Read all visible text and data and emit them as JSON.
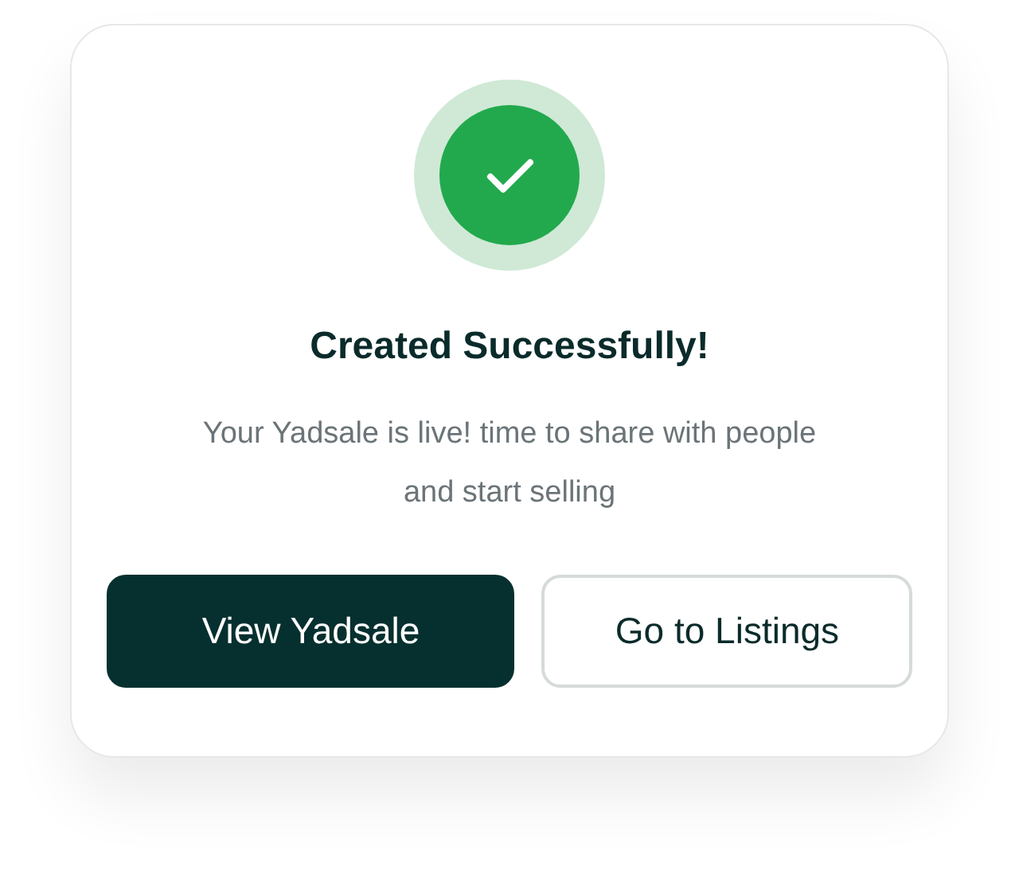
{
  "dialog": {
    "title": "Created Successfully!",
    "message": "Your Yadsale is live! time to share with people and start selling",
    "buttons": [
      {
        "label": "View Yadsale",
        "kind": "primary"
      },
      {
        "label": "Go to Listings",
        "kind": "secondary"
      }
    ]
  }
}
